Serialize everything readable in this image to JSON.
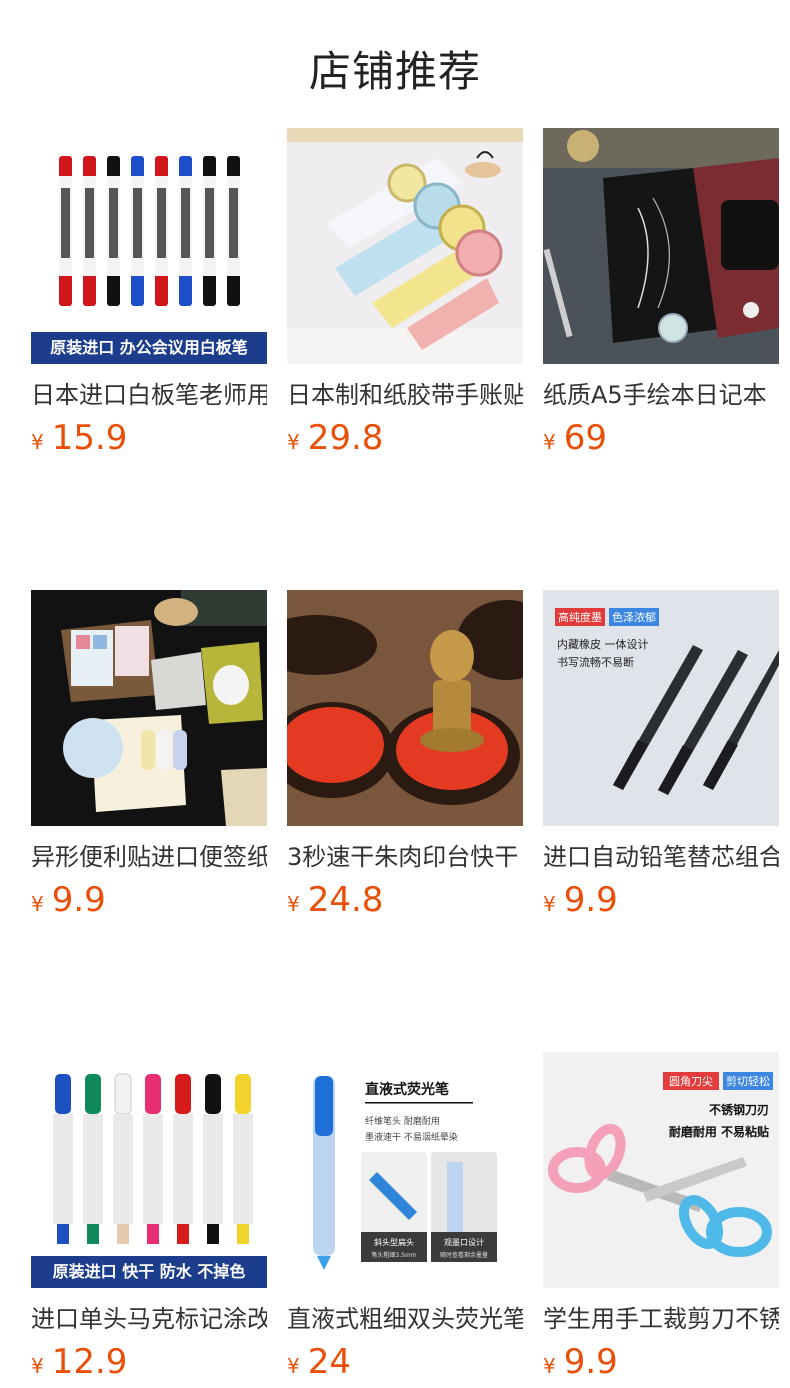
{
  "page": {
    "title": "店铺推荐"
  },
  "products": [
    {
      "name": "日本进口白板笔老师用",
      "currency": "¥",
      "price": "15.9",
      "banner": "原装进口 办公会议用白板笔"
    },
    {
      "name": "日本制和纸胶带手账贴纸",
      "currency": "¥",
      "price": "29.8"
    },
    {
      "name": "纸质A5手绘本日记本",
      "currency": "¥",
      "price": "69"
    },
    {
      "name": "异形便利贴进口便签纸",
      "currency": "¥",
      "price": "9.9"
    },
    {
      "name": "3秒速干朱肉印台快干",
      "currency": "¥",
      "price": "24.8"
    },
    {
      "name": "进口自动铅笔替芯组合",
      "currency": "¥",
      "price": "9.9",
      "tags": [
        "高纯度墨",
        "色泽浓郁"
      ],
      "lines": [
        "内藏橡皮 一体设计",
        "书写流畅不易断"
      ]
    },
    {
      "name": "进口单头马克标记涂改笔",
      "currency": "¥",
      "price": "12.9",
      "banner": "原装进口 快干 防水 不掉色"
    },
    {
      "name": "直液式粗细双头荧光笔",
      "currency": "¥",
      "price": "24",
      "headline": "直液式荧光笔",
      "lines": [
        "纤维笔头 耐磨耐用",
        "墨液速干 不易洇纸晕染"
      ],
      "captions": [
        "斜头型扁头",
        "笔头粗细3.5mm",
        "观墨口设计",
        "随时查看剩余墨量"
      ]
    },
    {
      "name": "学生用手工裁剪刀不锈钢",
      "currency": "¥",
      "price": "9.9",
      "tags": [
        "圆角刀尖",
        "剪切轻松"
      ],
      "lines": [
        "不锈钢刀刃",
        "耐磨耐用 不易粘贴"
      ]
    }
  ]
}
